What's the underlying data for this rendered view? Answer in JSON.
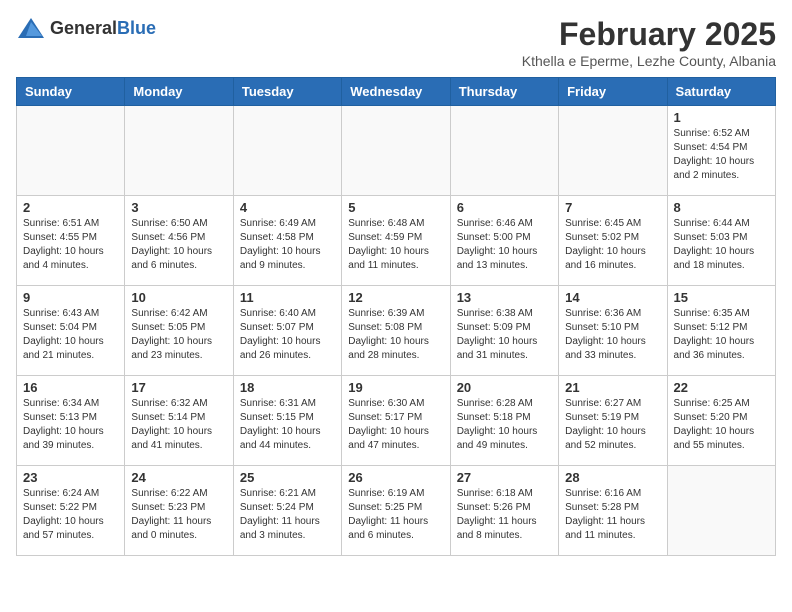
{
  "logo": {
    "general": "General",
    "blue": "Blue"
  },
  "title": "February 2025",
  "subtitle": "Kthella e Eperme, Lezhe County, Albania",
  "header": {
    "days": [
      "Sunday",
      "Monday",
      "Tuesday",
      "Wednesday",
      "Thursday",
      "Friday",
      "Saturday"
    ]
  },
  "weeks": [
    [
      {
        "day": "",
        "info": ""
      },
      {
        "day": "",
        "info": ""
      },
      {
        "day": "",
        "info": ""
      },
      {
        "day": "",
        "info": ""
      },
      {
        "day": "",
        "info": ""
      },
      {
        "day": "",
        "info": ""
      },
      {
        "day": "1",
        "info": "Sunrise: 6:52 AM\nSunset: 4:54 PM\nDaylight: 10 hours and 2 minutes."
      }
    ],
    [
      {
        "day": "2",
        "info": "Sunrise: 6:51 AM\nSunset: 4:55 PM\nDaylight: 10 hours and 4 minutes."
      },
      {
        "day": "3",
        "info": "Sunrise: 6:50 AM\nSunset: 4:56 PM\nDaylight: 10 hours and 6 minutes."
      },
      {
        "day": "4",
        "info": "Sunrise: 6:49 AM\nSunset: 4:58 PM\nDaylight: 10 hours and 9 minutes."
      },
      {
        "day": "5",
        "info": "Sunrise: 6:48 AM\nSunset: 4:59 PM\nDaylight: 10 hours and 11 minutes."
      },
      {
        "day": "6",
        "info": "Sunrise: 6:46 AM\nSunset: 5:00 PM\nDaylight: 10 hours and 13 minutes."
      },
      {
        "day": "7",
        "info": "Sunrise: 6:45 AM\nSunset: 5:02 PM\nDaylight: 10 hours and 16 minutes."
      },
      {
        "day": "8",
        "info": "Sunrise: 6:44 AM\nSunset: 5:03 PM\nDaylight: 10 hours and 18 minutes."
      }
    ],
    [
      {
        "day": "9",
        "info": "Sunrise: 6:43 AM\nSunset: 5:04 PM\nDaylight: 10 hours and 21 minutes."
      },
      {
        "day": "10",
        "info": "Sunrise: 6:42 AM\nSunset: 5:05 PM\nDaylight: 10 hours and 23 minutes."
      },
      {
        "day": "11",
        "info": "Sunrise: 6:40 AM\nSunset: 5:07 PM\nDaylight: 10 hours and 26 minutes."
      },
      {
        "day": "12",
        "info": "Sunrise: 6:39 AM\nSunset: 5:08 PM\nDaylight: 10 hours and 28 minutes."
      },
      {
        "day": "13",
        "info": "Sunrise: 6:38 AM\nSunset: 5:09 PM\nDaylight: 10 hours and 31 minutes."
      },
      {
        "day": "14",
        "info": "Sunrise: 6:36 AM\nSunset: 5:10 PM\nDaylight: 10 hours and 33 minutes."
      },
      {
        "day": "15",
        "info": "Sunrise: 6:35 AM\nSunset: 5:12 PM\nDaylight: 10 hours and 36 minutes."
      }
    ],
    [
      {
        "day": "16",
        "info": "Sunrise: 6:34 AM\nSunset: 5:13 PM\nDaylight: 10 hours and 39 minutes."
      },
      {
        "day": "17",
        "info": "Sunrise: 6:32 AM\nSunset: 5:14 PM\nDaylight: 10 hours and 41 minutes."
      },
      {
        "day": "18",
        "info": "Sunrise: 6:31 AM\nSunset: 5:15 PM\nDaylight: 10 hours and 44 minutes."
      },
      {
        "day": "19",
        "info": "Sunrise: 6:30 AM\nSunset: 5:17 PM\nDaylight: 10 hours and 47 minutes."
      },
      {
        "day": "20",
        "info": "Sunrise: 6:28 AM\nSunset: 5:18 PM\nDaylight: 10 hours and 49 minutes."
      },
      {
        "day": "21",
        "info": "Sunrise: 6:27 AM\nSunset: 5:19 PM\nDaylight: 10 hours and 52 minutes."
      },
      {
        "day": "22",
        "info": "Sunrise: 6:25 AM\nSunset: 5:20 PM\nDaylight: 10 hours and 55 minutes."
      }
    ],
    [
      {
        "day": "23",
        "info": "Sunrise: 6:24 AM\nSunset: 5:22 PM\nDaylight: 10 hours and 57 minutes."
      },
      {
        "day": "24",
        "info": "Sunrise: 6:22 AM\nSunset: 5:23 PM\nDaylight: 11 hours and 0 minutes."
      },
      {
        "day": "25",
        "info": "Sunrise: 6:21 AM\nSunset: 5:24 PM\nDaylight: 11 hours and 3 minutes."
      },
      {
        "day": "26",
        "info": "Sunrise: 6:19 AM\nSunset: 5:25 PM\nDaylight: 11 hours and 6 minutes."
      },
      {
        "day": "27",
        "info": "Sunrise: 6:18 AM\nSunset: 5:26 PM\nDaylight: 11 hours and 8 minutes."
      },
      {
        "day": "28",
        "info": "Sunrise: 6:16 AM\nSunset: 5:28 PM\nDaylight: 11 hours and 11 minutes."
      },
      {
        "day": "",
        "info": ""
      }
    ]
  ]
}
